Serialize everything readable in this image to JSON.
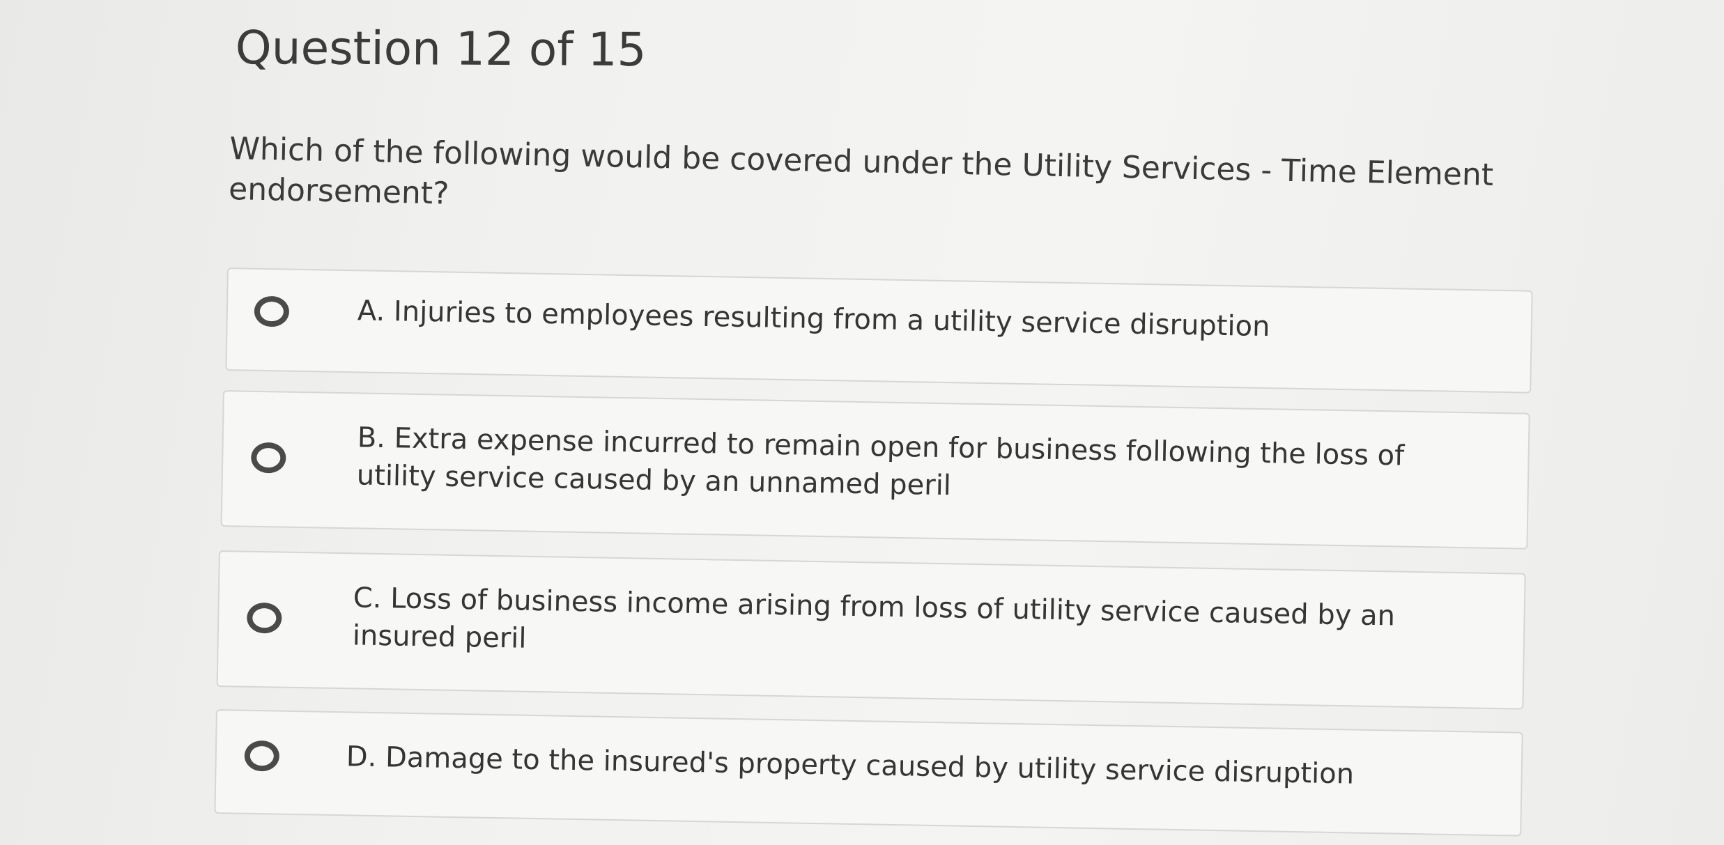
{
  "header": {
    "counter": "Question 12 of 15"
  },
  "question": {
    "text": "Which of the following would be covered under the Utility Services - Time Element endorsement?"
  },
  "options": [
    {
      "letter": "A",
      "label": "A. Injuries to employees resulting from a utility service disruption",
      "selected": false
    },
    {
      "letter": "B",
      "label": "B. Extra expense incurred to remain open for business following the loss of utility service caused by an unnamed peril",
      "selected": false
    },
    {
      "letter": "C",
      "label": "C. Loss of business income arising from loss of utility service caused by an insured peril",
      "selected": false
    },
    {
      "letter": "D",
      "label": "D. Damage to the insured's property caused by utility service disruption",
      "selected": false
    }
  ]
}
